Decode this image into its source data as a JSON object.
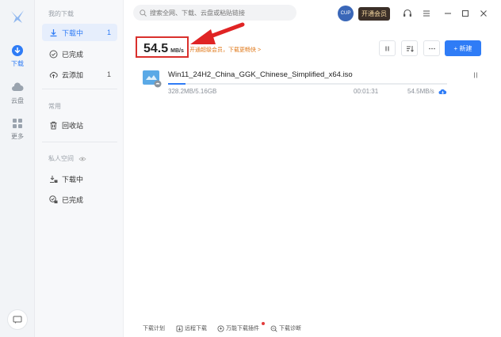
{
  "rail": {
    "items": [
      {
        "label": "下载",
        "icon": "download-icon",
        "active": true
      },
      {
        "label": "云盘",
        "icon": "cloud-icon",
        "active": false
      },
      {
        "label": "更多",
        "icon": "apps-grid-icon",
        "active": false
      }
    ]
  },
  "sidebar": {
    "section_mine": "我的下载",
    "items": [
      {
        "label": "下载中",
        "count": "1",
        "icon": "download-icon"
      },
      {
        "label": "已完成",
        "count": "",
        "icon": "check-circle-icon"
      },
      {
        "label": "云添加",
        "count": "1",
        "icon": "cloud-upload-icon"
      }
    ],
    "section_common": "常用",
    "recycle": "回收站",
    "section_private": "私人空间",
    "private_items": [
      {
        "label": "下载中",
        "icon": "lock-download-icon"
      },
      {
        "label": "已完成",
        "icon": "lock-check-icon"
      }
    ]
  },
  "search": {
    "placeholder": "搜索全网、下载、云盘或粘贴链接"
  },
  "header": {
    "avatar_text": "CUP",
    "vip_label": "开通会员"
  },
  "speed": {
    "value": "54.5",
    "unit": "MB/s",
    "hint": "开通超级会员，下载更畅快 >"
  },
  "toolbar": {
    "new_label": "+ 新建"
  },
  "task": {
    "name": "Win11_24H2_China_GGK_Chinese_Simplified_x64.iso",
    "size": "328.2MB/5.16GB",
    "time": "00:01:31",
    "speed": "54.5MB/s",
    "progress": 0.063
  },
  "footer": {
    "plan": "下载计划",
    "remote": "远程下载",
    "plugin": "万能下载插件",
    "diagnose": "下载诊断"
  },
  "colors": {
    "accent": "#2f7cf6",
    "highlight": "#d9302c",
    "hint": "#e07a1c"
  }
}
